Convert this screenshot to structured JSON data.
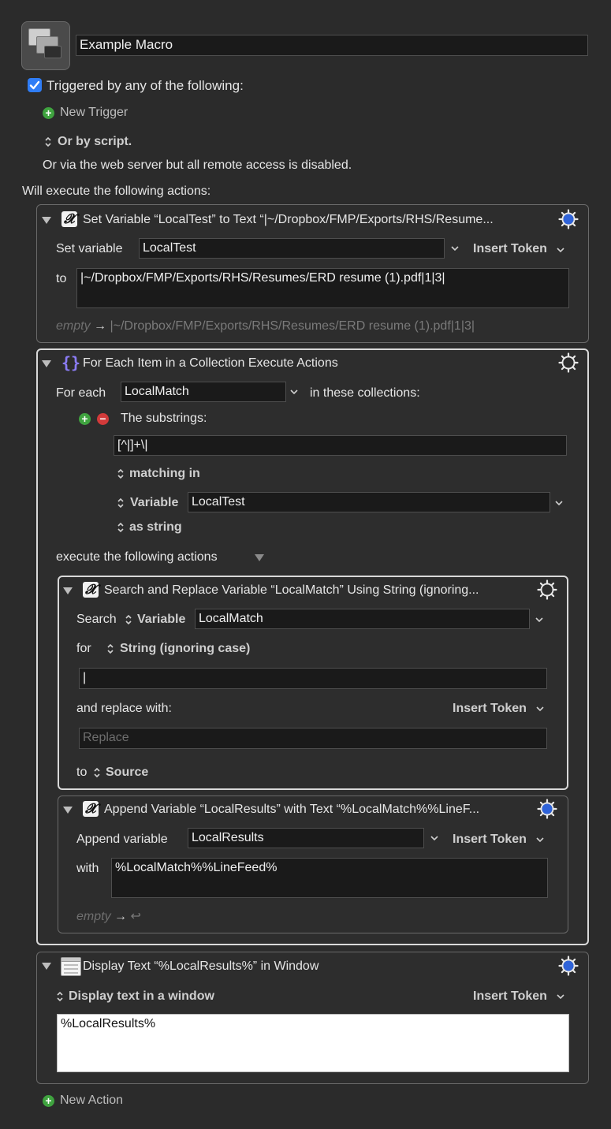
{
  "macro": {
    "name": "Example Macro",
    "triggered_label": "Triggered by any of the following:",
    "triggered_checked": true,
    "new_trigger": "New Trigger",
    "or_by_script": "Or by script.",
    "web_server_note": "Or via the web server but all remote access is disabled.",
    "will_execute": "Will execute the following actions:",
    "new_action": "New Action"
  },
  "actions": {
    "set_var": {
      "title": "Set Variable “LocalTest” to Text “|~/Dropbox/FMP/Exports/RHS/Resume...",
      "set_variable_label": "Set variable",
      "var_name": "LocalTest",
      "insert_token": "Insert Token",
      "to_label": "to",
      "value": "|~/Dropbox/FMP/Exports/RHS/Resumes/ERD resume (1).pdf|1|3|",
      "result_empty": "empty",
      "result_value": "|~/Dropbox/FMP/Exports/RHS/Resumes/ERD resume (1).pdf|1|3|"
    },
    "for_each": {
      "title": "For Each Item in a Collection Execute Actions",
      "for_each_label": "For each",
      "var_name": "LocalMatch",
      "in_collections": "in these collections:",
      "substrings_label": "The substrings:",
      "regex": "[^|]+\\|",
      "matching_in": "matching in",
      "variable_label": "Variable",
      "source_var": "LocalTest",
      "as_string": "as string",
      "execute_following": "execute the following actions"
    },
    "search_replace": {
      "title": "Search and Replace Variable “LocalMatch” Using String (ignoring...",
      "search_label": "Search",
      "variable_label": "Variable",
      "var_name": "LocalMatch",
      "for_label": "for",
      "mode": "String (ignoring case)",
      "search_value": "|",
      "replace_label": "and replace with:",
      "insert_token": "Insert Token",
      "replace_placeholder": "Replace",
      "to_label": "to",
      "source_label": "Source"
    },
    "append": {
      "title": "Append Variable “LocalResults” with Text “%LocalMatch%%LineF...",
      "append_label": "Append variable",
      "var_name": "LocalResults",
      "insert_token": "Insert Token",
      "with_label": "with",
      "value": "%LocalMatch%%LineFeed%",
      "result_empty": "empty",
      "result_symbol": "↩"
    },
    "display": {
      "title": "Display Text “%LocalResults%” in Window",
      "mode": "Display text in a window",
      "insert_token": "Insert Token",
      "value": "%LocalResults%"
    }
  },
  "colors": {
    "background": "#2b2b2b",
    "field": "#1a1a1a",
    "checkbox": "#2f7df6",
    "gear_enabled": "#2f63d9",
    "add_green": "#3fa33f",
    "remove_red": "#d23a3a"
  }
}
